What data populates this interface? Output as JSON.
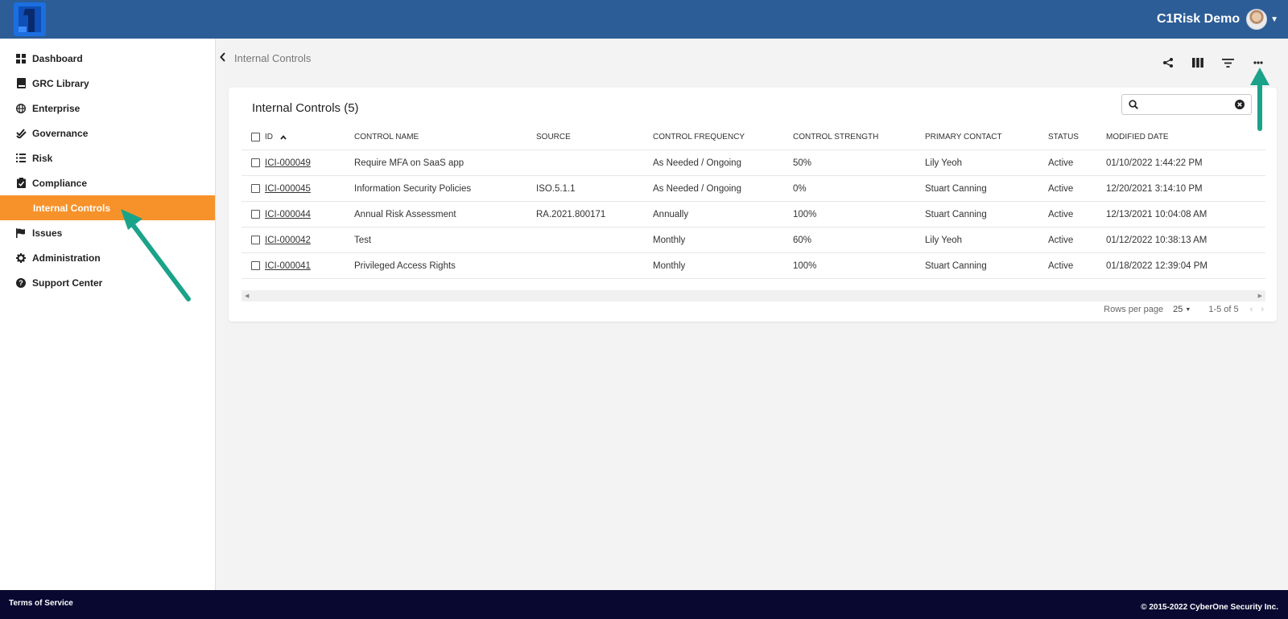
{
  "app": {
    "user_name": "C1Risk Demo",
    "brand_color": "#2d5d96",
    "accent_color": "#f7922a"
  },
  "sidebar": {
    "items": [
      {
        "label": "Dashboard",
        "icon": "grid-icon"
      },
      {
        "label": "GRC Library",
        "icon": "book-icon"
      },
      {
        "label": "Enterprise",
        "icon": "globe-icon"
      },
      {
        "label": "Governance",
        "icon": "check-double-icon"
      },
      {
        "label": "Risk",
        "icon": "list-icon"
      },
      {
        "label": "Compliance",
        "icon": "clipboard-check-icon"
      },
      {
        "label": "Internal Controls",
        "icon": "",
        "active": true
      },
      {
        "label": "Issues",
        "icon": "flag-icon"
      },
      {
        "label": "Administration",
        "icon": "gear-icon"
      },
      {
        "label": "Support Center",
        "icon": "question-circle-icon"
      }
    ]
  },
  "breadcrumb": "Internal Controls",
  "toolbar": {
    "icons": [
      "share-icon",
      "columns-icon",
      "filter-icon",
      "more-horizontal-icon"
    ]
  },
  "card": {
    "title": "Internal Controls (5)",
    "search_placeholder": ""
  },
  "table": {
    "columns": [
      "ID",
      "CONTROL NAME",
      "SOURCE",
      "CONTROL FREQUENCY",
      "CONTROL STRENGTH",
      "PRIMARY CONTACT",
      "STATUS",
      "MODIFIED DATE"
    ],
    "rows": [
      {
        "id": "ICI-000049",
        "name": "Require MFA on SaaS app",
        "source": "",
        "frequency": "As Needed / Ongoing",
        "strength": "50%",
        "contact": "Lily Yeoh",
        "status": "Active",
        "modified": "01/10/2022 1:44:22 PM"
      },
      {
        "id": "ICI-000045",
        "name": "Information Security Policies",
        "source": "ISO.5.1.1",
        "frequency": "As Needed / Ongoing",
        "strength": "0%",
        "contact": "Stuart Canning",
        "status": "Active",
        "modified": "12/20/2021 3:14:10 PM"
      },
      {
        "id": "ICI-000044",
        "name": "Annual Risk Assessment",
        "source": "RA.2021.800171",
        "frequency": "Annually",
        "strength": "100%",
        "contact": "Stuart Canning",
        "status": "Active",
        "modified": "12/13/2021 10:04:08 AM"
      },
      {
        "id": "ICI-000042",
        "name": "Test",
        "source": "",
        "frequency": "Monthly",
        "strength": "60%",
        "contact": "Lily Yeoh",
        "status": "Active",
        "modified": "01/12/2022 10:38:13 AM"
      },
      {
        "id": "ICI-000041",
        "name": "Privileged Access Rights",
        "source": "",
        "frequency": "Monthly",
        "strength": "100%",
        "contact": "Stuart Canning",
        "status": "Active",
        "modified": "01/18/2022 12:39:04 PM"
      }
    ]
  },
  "pagination": {
    "rows_per_page_label": "Rows per page",
    "rows_per_page_value": "25",
    "range": "1-5 of 5"
  },
  "footer": {
    "terms": "Terms of Service",
    "copyright": "© 2015-2022 CyberOne Security Inc."
  }
}
